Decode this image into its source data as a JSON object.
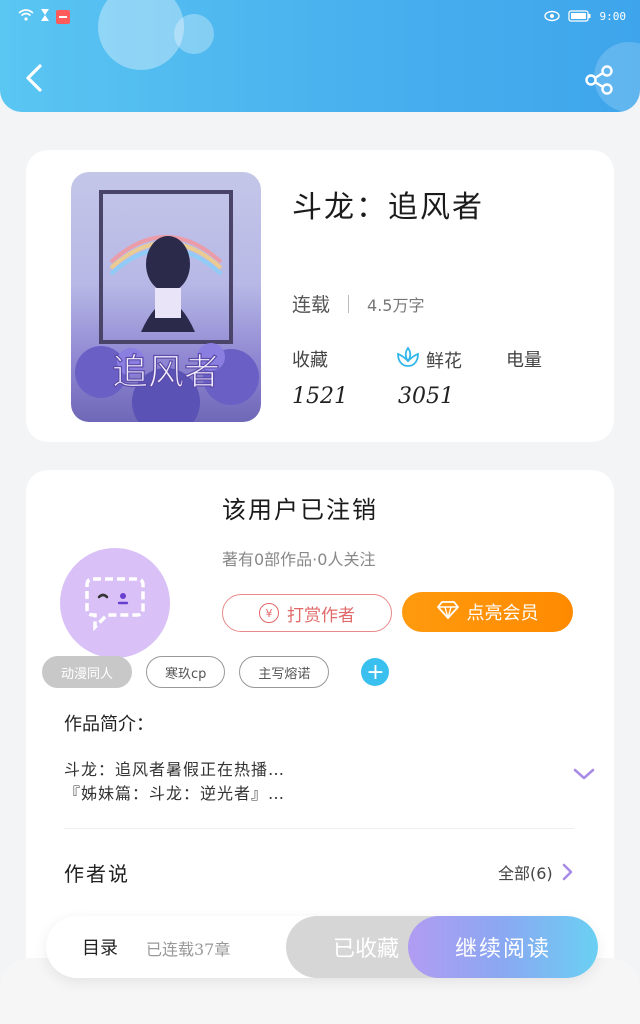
{
  "status_bar": {
    "time": "9:00",
    "icons": [
      "wifi-icon",
      "hourglass-icon",
      "notification-badge-icon",
      "eye-icon",
      "battery-icon"
    ]
  },
  "header": {
    "back_icon": "chevron-left-icon",
    "share_icon": "share-icon"
  },
  "book": {
    "title": "斗龙：追风者",
    "status": "连载",
    "word_count": "4.5万字",
    "stats": {
      "collect_label": "收藏",
      "collect_value": "1521",
      "flower_label": "鲜花",
      "flower_value": "3051",
      "power_label": "电量",
      "power_value": ""
    },
    "cover_text": "追风者"
  },
  "author": {
    "name": "该用户已注销",
    "meta": "著有0部作品·0人关注",
    "tip_label": "打赏作者",
    "tip_symbol": "¥",
    "vip_label": "点亮会员",
    "tags": [
      "动漫同人",
      "寒玖cp",
      "主写熔诺"
    ],
    "add_tag": "+"
  },
  "intro": {
    "title": "作品简介：",
    "line1": "斗龙：追风者暑假正在热播…",
    "line2": "『姊妹篇：斗龙：逆光者』…"
  },
  "author_says": {
    "title": "作者说",
    "all_label": "全部(6)"
  },
  "bottom_bar": {
    "toc_label": "目录",
    "toc_info": "已连载37章",
    "collected_label": "已收藏",
    "continue_label": "继续阅读"
  },
  "colors": {
    "header": "#4ab2ee",
    "vip": "#ff9a0e",
    "tip": "#e06a6a",
    "continue_start": "#b19cf2",
    "continue_end": "#6ad0f3",
    "avatar": "#d9c1f7"
  }
}
